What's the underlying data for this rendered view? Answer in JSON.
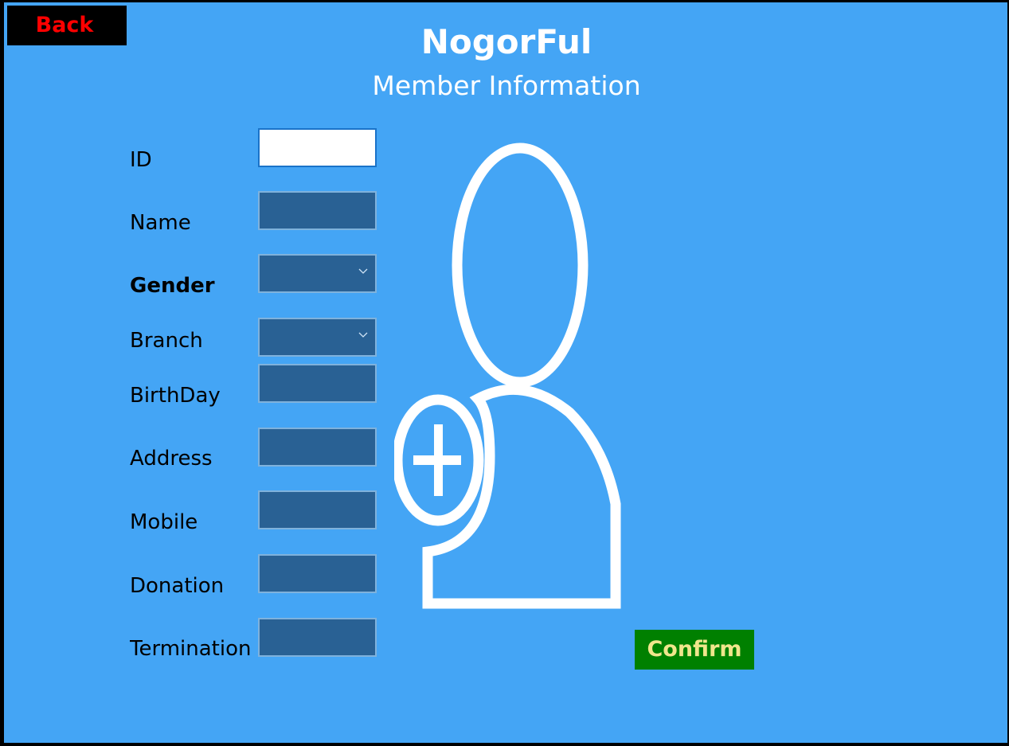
{
  "header": {
    "back_label": "Back",
    "app_title": "NogorFul",
    "page_title": "Member Information"
  },
  "form": {
    "fields": [
      {
        "label": "ID",
        "type": "text",
        "value": ""
      },
      {
        "label": "Name",
        "type": "text",
        "value": ""
      },
      {
        "label": "Gender",
        "type": "select",
        "value": ""
      },
      {
        "label": "Branch",
        "type": "select",
        "value": ""
      },
      {
        "label": "BirthDay",
        "type": "text",
        "value": ""
      },
      {
        "label": "Address",
        "type": "text",
        "value": ""
      },
      {
        "label": "Mobile",
        "type": "text",
        "value": ""
      },
      {
        "label": "Donation",
        "type": "text",
        "value": ""
      },
      {
        "label": "Termination",
        "type": "text",
        "value": ""
      }
    ]
  },
  "avatar": {
    "icon": "add-user-icon"
  },
  "confirm_label": "Confirm",
  "colors": {
    "background": "#44a5f5",
    "field_background": "#296194",
    "back_button_text": "#ff0000",
    "confirm_button_background": "#008000",
    "confirm_button_text": "#f0e68c"
  }
}
